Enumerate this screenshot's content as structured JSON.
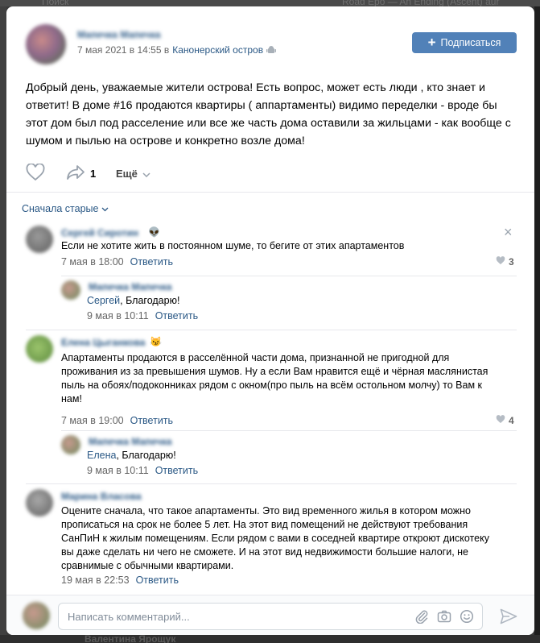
{
  "background": {
    "top_left_text": "Поиск",
    "top_right_text": "Road Epo — An Ending (Ascent) aur",
    "bottom_name": "Валентина Ярощук"
  },
  "post": {
    "author": "Мапечка Мапечка",
    "date": "7 мая 2021 в 14:55 в",
    "location": "Канонерский остров",
    "subscribe_label": "Подписаться",
    "text": "Добрый день, уважаемые жители острова! Есть вопрос, может есть люди , кто знает и ответит! В доме #16 продаются квартиры ( аппартаменты) видимо переделки - вроде бы этот дом был под расселение или все же часть дома оставили за жильцами - как вообще с шумом и пылью на острове и конкретно возле дома!",
    "share_count": "1",
    "more_label": "Ещё"
  },
  "sort_label": "Сначала старые",
  "comments": [
    {
      "author": "Сергей Сиротин",
      "emoji": "👽",
      "text": "Если не хотите жить в постоянном шуме, то бегите от этих апартаментов",
      "date": "7 мая в 18:00",
      "reply_label": "Ответить",
      "likes": "3"
    },
    {
      "author": "Мапечка Мапечка",
      "ref": "Сергей",
      "text": ", Благодарю!",
      "date": "9 мая в 10:11",
      "reply_label": "Ответить"
    },
    {
      "author": "Елена Цыганкова",
      "emoji": "😼",
      "text": "Апартаменты продаются в расселённой части дома, признанной не пригодной для проживания из за превышения шумов. Ну а если Вам нравится ещё и чёрная маслянистая пыль на обоях/подоконниках рядом с окном(про пыль на всём остольном молчу) то Вам к нам!",
      "date": "7 мая в 19:00",
      "reply_label": "Ответить",
      "likes": "4"
    },
    {
      "author": "Мапечка Мапечка",
      "ref": "Елена",
      "text": ", Благодарю!",
      "date": "9 мая в 10:11",
      "reply_label": "Ответить"
    },
    {
      "author": "Марина Власова",
      "text": "Оцените сначала, что такое апартаменты. Это вид временного жилья в котором можно прописаться на срок не более 5 лет. На этот вид помещений не действуют требования СанПиН к жилым помещениям. Если рядом с вами в соседней квартире откроют дискотеку вы даже сделать ни чего не сможете. И на этот вид недвижимости большие налоги, не сравнимые с обычными квартирами.",
      "date": "19 мая в 22:53",
      "reply_label": "Ответить"
    }
  ],
  "composer": {
    "placeholder": "Написать комментарий..."
  },
  "colors": {
    "link": "#2a5885",
    "button": "#5181b8",
    "muted": "#656565"
  }
}
